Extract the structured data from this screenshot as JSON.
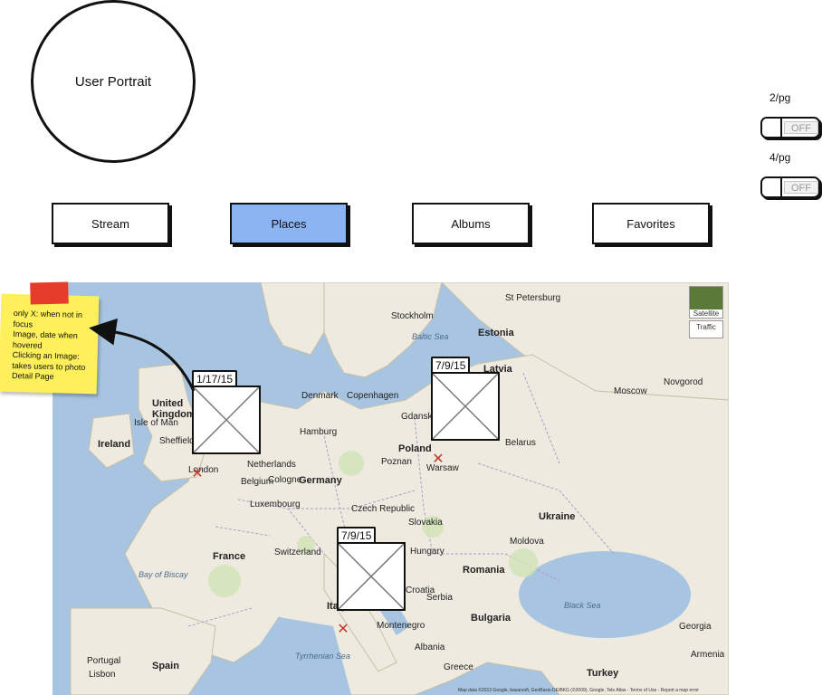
{
  "header": {
    "portrait_label": "User Portrait"
  },
  "layout_toggles": [
    {
      "label": "2/pg",
      "state": "OFF"
    },
    {
      "label": "4/pg",
      "state": "OFF"
    }
  ],
  "nav": {
    "active": "Places",
    "items": [
      {
        "label": "Stream"
      },
      {
        "label": "Places"
      },
      {
        "label": "Albums"
      },
      {
        "label": "Favorites"
      }
    ]
  },
  "map": {
    "controls": {
      "satellite": "Satellite",
      "traffic": "Traffic"
    },
    "labels": {
      "st_petersburg": "St Petersburg",
      "estonia": "Estonia",
      "latvia": "Latvia",
      "moscow": "Moscow",
      "novgorod": "Novgorod",
      "stockholm": "Stockholm",
      "baltic_sea": "Baltic Sea",
      "denmark": "Denmark",
      "copenhagen": "Copenhagen",
      "united_kingdom": "United Kingdom",
      "isle_of_man": "Isle of Man",
      "sheffield": "Sheffield",
      "ireland": "Ireland",
      "london": "London",
      "netherlands": "Netherlands",
      "hamburg": "Hamburg",
      "germany": "Germany",
      "belgium": "Belgium",
      "luxembourg": "Luxembourg",
      "cologne": "Cologne",
      "gdansk": "Gdansk",
      "poland": "Poland",
      "poznan": "Poznan",
      "warsaw": "Warsaw",
      "belarus": "Belarus",
      "czech_republic": "Czech Republic",
      "slovakia": "Slovakia",
      "ukraine": "Ukraine",
      "france": "France",
      "switzerland": "Switzerland",
      "hungary": "Hungary",
      "moldova": "Moldova",
      "romania": "Romania",
      "bay_of_biscay": "Bay of Biscay",
      "italy": "Italy",
      "croatia": "Croatia",
      "serbia": "Serbia",
      "bulgaria": "Bulgaria",
      "black_sea": "Black Sea",
      "montenegro": "Montenegro",
      "albania": "Albania",
      "portugal": "Portugal",
      "lisbon": "Lisbon",
      "spain": "Spain",
      "greece": "Greece",
      "turkey": "Turkey",
      "georgia": "Georgia",
      "armenia": "Armenia",
      "tyrrhenian_sea": "Tyrrhenian Sea",
      "attribution": "Map data ©2013 Google, basarsoft, GeoBasis-DE/BKG (©2009), Google, Tele Atlas - Terms of Use - Report a map error"
    },
    "photo_markers": [
      {
        "date": "1/17/15"
      },
      {
        "date": "7/9/15"
      },
      {
        "date": "7/9/15"
      }
    ]
  },
  "annotation": {
    "lines": [
      "only X: when not in focus",
      "Image, date when hovered",
      "Clicking an Image: takes users to photo Detail Page"
    ]
  },
  "colors": {
    "active_tab": "#8bb4f2",
    "sticky_note": "#fdf05a",
    "sticky_tape": "#e63c2c",
    "pin": "#c0392b",
    "water": "#a7c4e0",
    "land": "#eeeae0"
  },
  "icons": {
    "photo_placeholder": "crossed-box-icon",
    "location_pin": "x-mark-icon"
  }
}
